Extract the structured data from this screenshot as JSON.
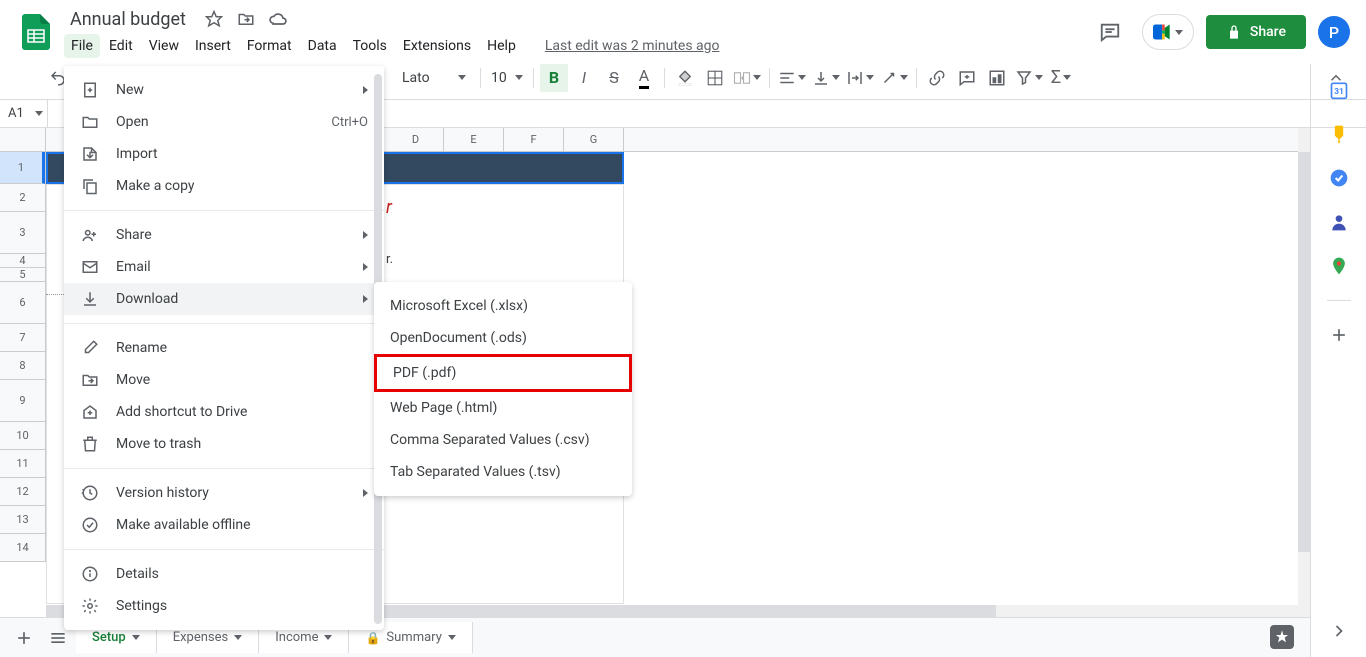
{
  "doc": {
    "title": "Annual budget",
    "last_edit": "Last edit was 2 minutes ago"
  },
  "menubar": [
    "File",
    "Edit",
    "View",
    "Insert",
    "Format",
    "Data",
    "Tools",
    "Extensions",
    "Help"
  ],
  "share_label": "Share",
  "avatar_letter": "P",
  "toolbar": {
    "font": "Lato",
    "size": "10"
  },
  "namebox": "A1",
  "col_headers": [
    "D",
    "E",
    "F",
    "G"
  ],
  "row_numbers": [
    "1",
    "2",
    "3",
    "4",
    "5",
    "6",
    "7",
    "8",
    "9",
    "10",
    "11",
    "12",
    "13",
    "14"
  ],
  "cell_fragment_r": "r",
  "cell_fragment_period": "r.",
  "tabs": {
    "active": "Setup",
    "items": [
      "Setup",
      "Expenses",
      "Income",
      "Summary"
    ]
  },
  "file_menu": {
    "items": [
      {
        "icon": "new",
        "label": "New",
        "sub": true
      },
      {
        "icon": "open",
        "label": "Open",
        "shortcut": "Ctrl+O"
      },
      {
        "icon": "import",
        "label": "Import"
      },
      {
        "icon": "copy",
        "label": "Make a copy"
      },
      {
        "divider": true
      },
      {
        "icon": "share",
        "label": "Share",
        "sub": true
      },
      {
        "icon": "email",
        "label": "Email",
        "sub": true
      },
      {
        "icon": "download",
        "label": "Download",
        "sub": true,
        "hover": true
      },
      {
        "divider": true
      },
      {
        "icon": "rename",
        "label": "Rename"
      },
      {
        "icon": "move",
        "label": "Move"
      },
      {
        "icon": "shortcut",
        "label": "Add shortcut to Drive"
      },
      {
        "icon": "trash",
        "label": "Move to trash"
      },
      {
        "divider": true
      },
      {
        "icon": "history",
        "label": "Version history",
        "sub": true
      },
      {
        "icon": "offline",
        "label": "Make available offline"
      },
      {
        "divider": true
      },
      {
        "icon": "details",
        "label": "Details"
      },
      {
        "icon": "settings",
        "label": "Settings"
      }
    ]
  },
  "download_menu": [
    {
      "label": "Microsoft Excel (.xlsx)"
    },
    {
      "label": "OpenDocument (.ods)"
    },
    {
      "label": "PDF (.pdf)",
      "highlighted": true
    },
    {
      "label": "Web Page (.html)"
    },
    {
      "label": "Comma Separated Values (.csv)"
    },
    {
      "label": "Tab Separated Values (.tsv)"
    }
  ]
}
